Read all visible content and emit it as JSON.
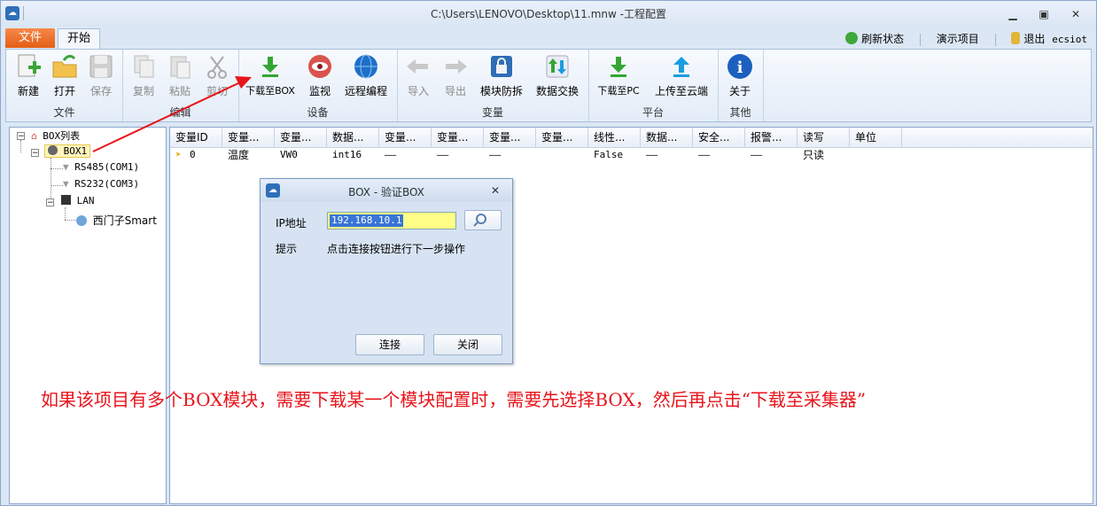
{
  "window": {
    "title": "C:\\Users\\LENOVO\\Desktop\\11.mnw  -工程配置",
    "app_icon": "cloud-icon",
    "controls": [
      "minimize-icon",
      "maximize-icon",
      "close-icon"
    ]
  },
  "tabs": [
    {
      "label": "文件"
    },
    {
      "label": "开始"
    }
  ],
  "top_right": {
    "refresh_label": "刷新状态",
    "demo_label": "演示项目",
    "logout_label": "退出",
    "user": "ecsiot"
  },
  "ribbon": {
    "groups": [
      {
        "label": "文件",
        "buttons": [
          {
            "label": "新建",
            "icon": "new-doc-icon"
          },
          {
            "label": "打开",
            "icon": "open-folder-icon"
          },
          {
            "label": "保存",
            "icon": "save-icon"
          }
        ]
      },
      {
        "label": "编辑",
        "buttons": [
          {
            "label": "复制",
            "icon": "copy-icon"
          },
          {
            "label": "粘贴",
            "icon": "paste-icon"
          },
          {
            "label": "剪切",
            "icon": "cut-icon"
          }
        ]
      },
      {
        "label": "设备",
        "buttons": [
          {
            "label": "下载至BOX",
            "icon": "download-icon"
          },
          {
            "label": "监视",
            "icon": "eye-icon"
          },
          {
            "label": "远程编程",
            "icon": "globe-icon"
          }
        ]
      },
      {
        "label": "变量",
        "buttons": [
          {
            "label": "导入",
            "icon": "import-icon"
          },
          {
            "label": "导出",
            "icon": "export-icon"
          },
          {
            "label": "模块防拆",
            "icon": "lock-shield-icon"
          },
          {
            "label": "数据交换",
            "icon": "exchange-icon"
          }
        ]
      },
      {
        "label": "平台",
        "buttons": [
          {
            "label": "下载至PC",
            "icon": "download-pc-icon"
          },
          {
            "label": "上传至云端",
            "icon": "upload-icon"
          }
        ]
      },
      {
        "label": "其他",
        "buttons": [
          {
            "label": "关于",
            "icon": "info-icon"
          }
        ]
      }
    ]
  },
  "tree": {
    "root": "BOX列表",
    "box": "BOX1",
    "rs485": "RS485(COM1)",
    "rs232": "RS232(COM3)",
    "lan": "LAN",
    "device": "西门子Smart"
  },
  "grid": {
    "columns": [
      "变量ID",
      "变量...",
      "变量...",
      "数据...",
      "变量...",
      "变量...",
      "变量...",
      "变量...",
      "线性...",
      "数据...",
      "安全...",
      "报警...",
      "读写",
      "单位"
    ],
    "rows": [
      [
        "0",
        "温度",
        "VW0",
        "int16",
        "——",
        "——",
        "——",
        "",
        "False",
        "——",
        "——",
        "——",
        "只读",
        ""
      ]
    ]
  },
  "dialog": {
    "title": "BOX - 验证BOX",
    "ip_label": "IP地址",
    "ip_value": "192.168.10.1",
    "hint_label": "提示",
    "hint_text": "点击连接按钮进行下一步操作",
    "connect_label": "连接",
    "close_label": "关闭"
  },
  "annotation": "如果该项目有多个BOX模块，需要下载某一个模块配置时，需要先选择BOX，然后再点击“下载至采集器”",
  "colors": {
    "accent_orange": "#e45e15",
    "annotation_red": "#e8141b",
    "download_green": "#34a534",
    "upload_blue": "#1a9de0",
    "selection_yellow": "#ffff88"
  }
}
